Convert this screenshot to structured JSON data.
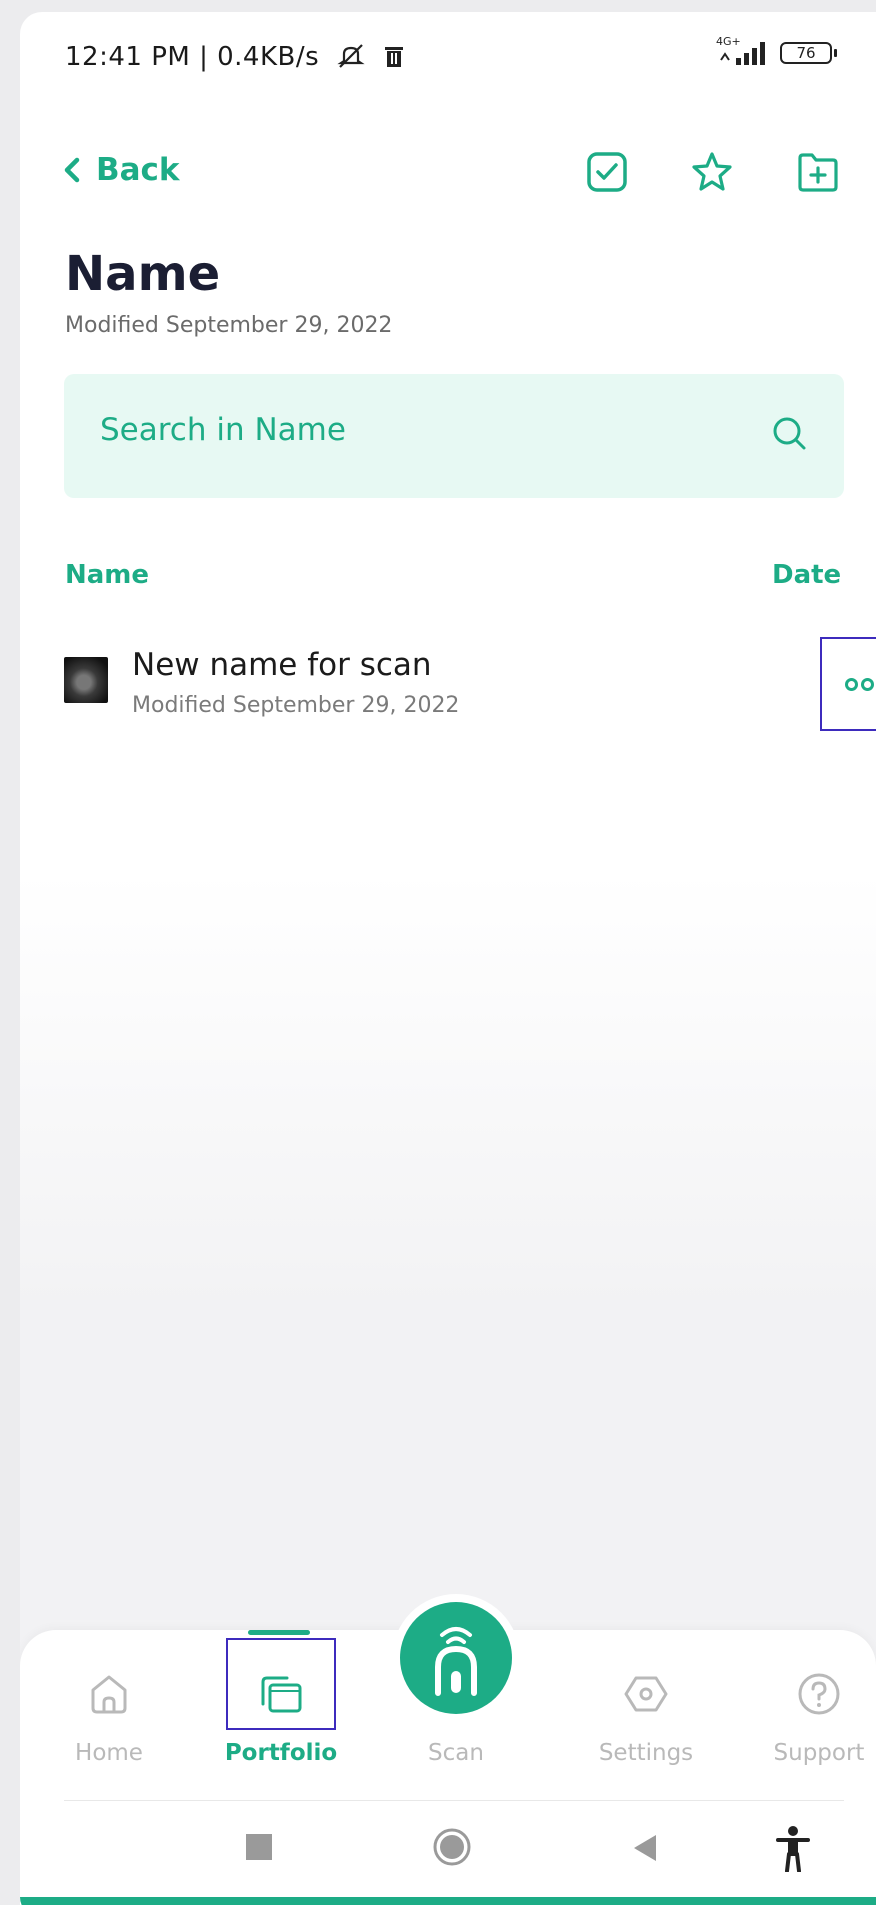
{
  "status_bar": {
    "time_text": "12:41 PM | 0.4KB/s",
    "network_label": "4G+",
    "battery": "76"
  },
  "header": {
    "back_label": "Back"
  },
  "folder": {
    "title": "Name",
    "modified": "Modified September 29, 2022"
  },
  "search": {
    "placeholder": "Search in Name"
  },
  "list": {
    "columns": [
      "Name",
      "Date"
    ],
    "items": [
      {
        "title": "New name for scan",
        "modified": "Modified September 29, 2022"
      }
    ]
  },
  "nav": {
    "items": [
      {
        "label": "Home",
        "icon": "home-icon"
      },
      {
        "label": "Portfolio",
        "icon": "portfolio-icon",
        "active": true
      },
      {
        "label": "Scan",
        "icon": "scan-probe-icon"
      },
      {
        "label": "Settings",
        "icon": "settings-icon"
      },
      {
        "label": "Support",
        "icon": "help-icon"
      }
    ]
  },
  "colors": {
    "accent": "#1dac86",
    "search_bg": "#e7f9f3",
    "title": "#1b1e33",
    "highlight_box": "#3d2bbd"
  }
}
